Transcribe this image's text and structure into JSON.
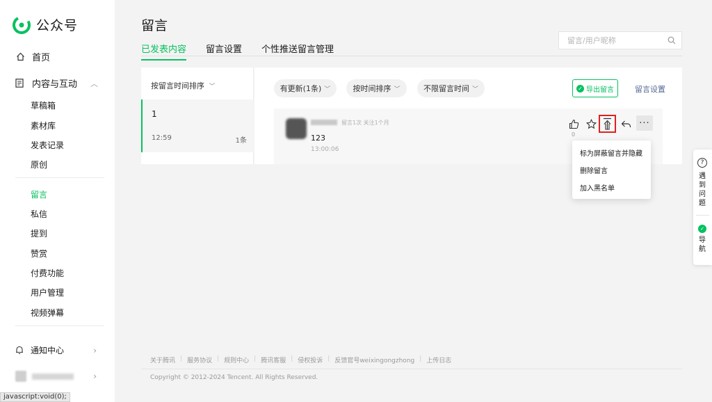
{
  "app": {
    "name": "公众号",
    "brand_color": "#07c160",
    "logo_icon": "wechat-mp-logo-icon"
  },
  "sidebar": {
    "home": "首页",
    "content_section": "内容与互动",
    "items": [
      "草稿箱",
      "素材库",
      "发表记录",
      "原创"
    ],
    "items2": [
      "留言",
      "私信",
      "提到",
      "赞赏",
      "付费功能",
      "用户管理",
      "视频弹幕"
    ],
    "active": "留言",
    "notify": "通知中心"
  },
  "header": {
    "title": "留言",
    "tabs": [
      "已发表内容",
      "留言设置",
      "个性推送留言管理"
    ],
    "active_tab": "已发表内容",
    "search_placeholder": "留言/用户昵称"
  },
  "article_list": {
    "sort_label": "按留言时间排序",
    "items": [
      {
        "title": "1",
        "time": "12:59",
        "count": "1条"
      }
    ]
  },
  "filters": {
    "update": "有更新(1条)",
    "sort": "按时间排序",
    "time": "不限留言时间",
    "export": "导出留言",
    "settings": "留言设置"
  },
  "comment": {
    "meta": "留言1次 关注1个月",
    "text": "123",
    "time": "13:00:06",
    "likes": "0"
  },
  "menu": {
    "items": [
      "标为屏蔽留言并隐藏",
      "删除留言",
      "加入黑名单"
    ]
  },
  "footer": {
    "links": [
      "关于腾讯",
      "服务协议",
      "规则中心",
      "腾讯客服",
      "侵权投诉",
      "反馈官号weixingongzhong",
      "上传日志"
    ],
    "copyright": "Copyright © 2012-2024 Tencent. All Rights Reserved."
  },
  "helper": {
    "help": "遇到问题",
    "nav": "导航"
  },
  "status_bar": "javascript:void(0);"
}
